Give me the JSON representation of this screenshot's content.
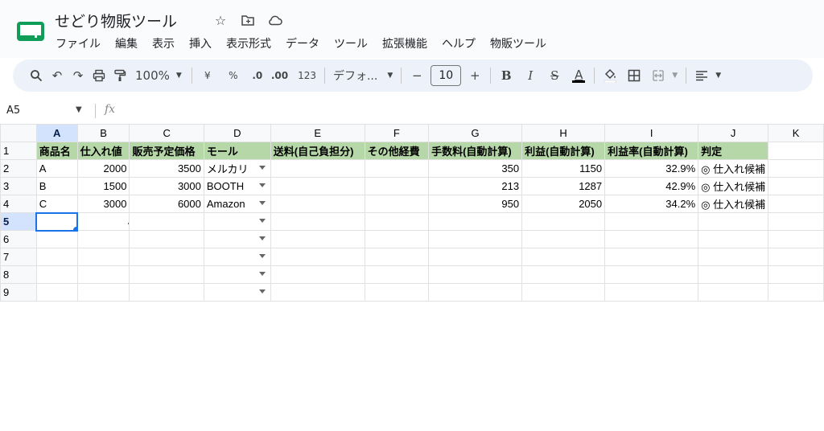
{
  "app": {
    "title": "せどり物販ツール"
  },
  "menu": [
    "ファイル",
    "編集",
    "表示",
    "挿入",
    "表示形式",
    "データ",
    "ツール",
    "拡張機能",
    "ヘルプ",
    "物販ツール"
  ],
  "toolbar": {
    "zoom": "100%",
    "currency": "¥",
    "percent": "%",
    "dec_decrease": ".0",
    "dec_increase": ".00",
    "number_format": "123",
    "font": "デフォ...",
    "font_size": "10",
    "minus": "−",
    "plus": "+",
    "bold": "B",
    "italic": "I",
    "strike": "S",
    "text_color": "A"
  },
  "formula_bar": {
    "name_box": "A5",
    "fx": "fx"
  },
  "grid": {
    "columns": [
      "A",
      "B",
      "C",
      "D",
      "E",
      "F",
      "G",
      "H",
      "I",
      "J",
      "K"
    ],
    "rows": [
      "1",
      "2",
      "3",
      "4",
      "5",
      "6",
      "7",
      "8",
      "9"
    ],
    "header": [
      "商品名",
      "仕入れ値",
      "販売予定価格",
      "モール",
      "送料(自己負担分)",
      "その他経費",
      "手数料(自動計算)",
      "利益(自動計算)",
      "利益率(自動計算)",
      "判定",
      ""
    ],
    "data": [
      [
        "A",
        "2000",
        "3500",
        "メルカリ",
        "",
        "",
        "350",
        "1150",
        "32.9%",
        "◎ 仕入れ候補",
        ""
      ],
      [
        "B",
        "1500",
        "3000",
        "BOOTH",
        "",
        "",
        "213",
        "1287",
        "42.9%",
        "◎ 仕入れ候補",
        ""
      ],
      [
        "C",
        "3000",
        "6000",
        "Amazon",
        "",
        "",
        "950",
        "2050",
        "34.2%",
        "◎ 仕入れ候補",
        ""
      ]
    ],
    "active_cell": "A5"
  },
  "colors": {
    "header_fill": "#b6d7a8",
    "selection": "#1a73e8",
    "toolbar_bg": "#edf2fa"
  }
}
